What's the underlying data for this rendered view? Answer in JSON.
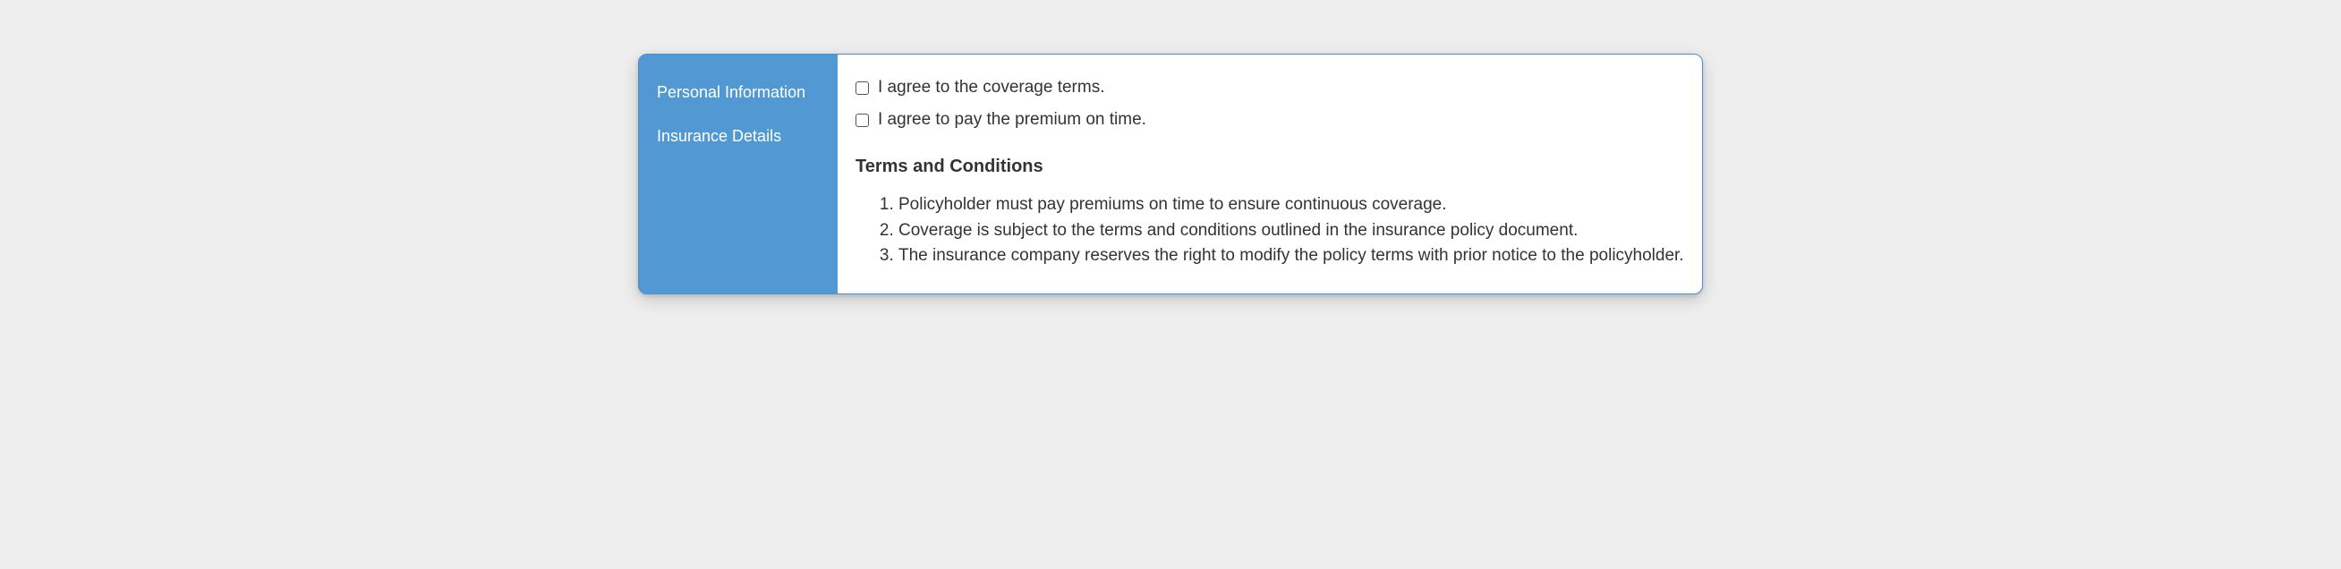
{
  "sidebar": {
    "items": [
      {
        "label": "Personal Information"
      },
      {
        "label": "Insurance Details"
      }
    ]
  },
  "content": {
    "agree_coverage_label": "I agree to the coverage terms.",
    "agree_premium_label": "I agree to pay the premium on time.",
    "terms_heading": "Terms and Conditions",
    "terms": [
      "Policyholder must pay premiums on time to ensure continuous coverage.",
      "Coverage is subject to the terms and conditions outlined in the insurance policy document.",
      "The insurance company reserves the right to modify the policy terms with prior notice to the policyholder."
    ]
  }
}
